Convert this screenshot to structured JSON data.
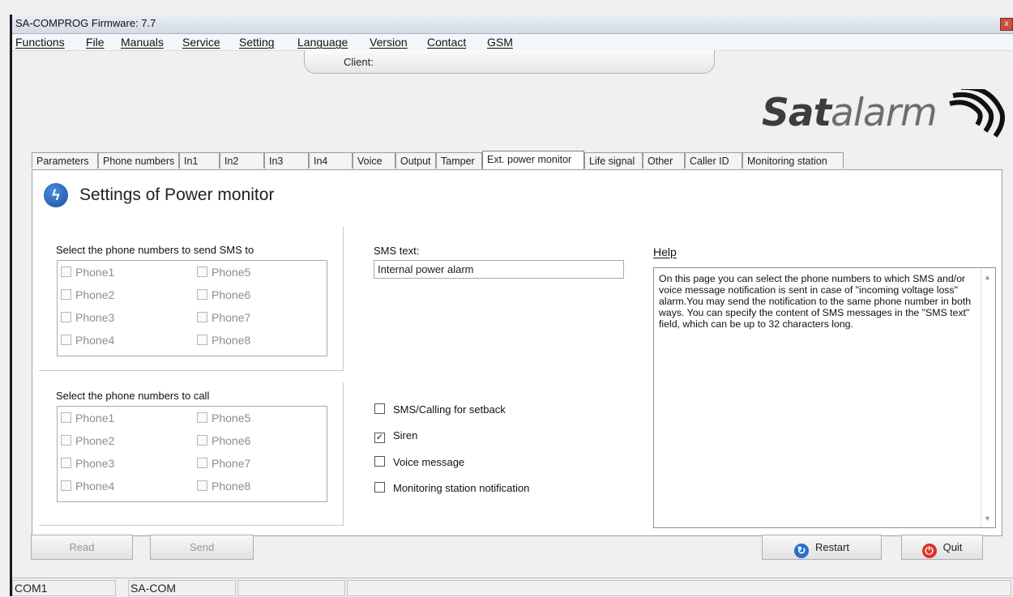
{
  "window": {
    "title": "SA-COMPROG Firmware: 7.7",
    "close_glyph": "x"
  },
  "menu": [
    "Functions",
    "File",
    "Manuals",
    "Service",
    "Setting",
    "Language",
    "Version",
    "Contact",
    "GSM"
  ],
  "client_label": "Client:",
  "logo": {
    "part1": "Sat",
    "part2": "alarm"
  },
  "tabs": [
    "Parameters",
    "Phone numbers",
    "In1",
    "In2",
    "In3",
    "In4",
    "Voice",
    "Output",
    "Tamper",
    "Ext. power monitor",
    "Life signal",
    "Other",
    "Caller ID",
    "Monitoring station"
  ],
  "active_tab": "Ext. power monitor",
  "page": {
    "title": "Settings of Power monitor",
    "icon": "lightning-icon"
  },
  "sms_group": {
    "label": "Select the phone numbers to send SMS to",
    "phones": [
      "Phone1",
      "Phone2",
      "Phone3",
      "Phone4",
      "Phone5",
      "Phone6",
      "Phone7",
      "Phone8"
    ]
  },
  "call_group": {
    "label": "Select the phone numbers to call",
    "phones": [
      "Phone1",
      "Phone2",
      "Phone3",
      "Phone4",
      "Phone5",
      "Phone6",
      "Phone7",
      "Phone8"
    ]
  },
  "sms_text": {
    "label": "SMS text:",
    "value": "Internal power alarm"
  },
  "options": [
    {
      "label": "SMS/Calling for setback",
      "checked": false
    },
    {
      "label": "Siren",
      "checked": true
    },
    {
      "label": "Voice message",
      "checked": false
    },
    {
      "label": "Monitoring station notification",
      "checked": false
    }
  ],
  "help": {
    "label": "Help",
    "text": "On this page you can select the phone numbers to which SMS and/or voice message notification is sent in case of \"incoming voltage loss\" alarm.You may send the notification to the same phone number in both ways. You can specify the content of SMS messages in the \"SMS text\" field, which can be up to 32 characters long."
  },
  "buttons": {
    "read": "Read",
    "send": "Send",
    "restart": "Restart",
    "quit": "Quit"
  },
  "status": [
    "COM1",
    "SA-COM",
    "",
    ""
  ],
  "colors": {
    "accent": "#1b4f9e",
    "quit": "#d9332a",
    "restart": "#2a6fc9"
  }
}
